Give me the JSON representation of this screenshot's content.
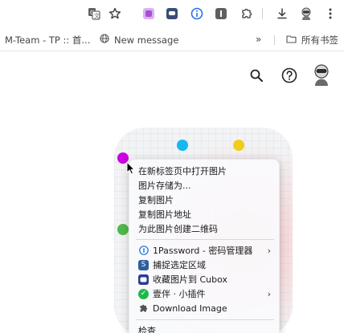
{
  "toolbar": {
    "translate_icon": "translate-icon",
    "star_icon": "bookmark-star-icon",
    "extensions": [
      {
        "name": "extension-purple",
        "color": "#b66be0"
      },
      {
        "name": "extension-dark-blue",
        "color": "#3b4c78"
      },
      {
        "name": "extension-blue-info",
        "color": "#2f6fe0"
      },
      {
        "name": "extension-gray",
        "color": "#6b6b6b"
      }
    ],
    "puzzle_icon": "extensions-puzzle-icon",
    "download_icon": "download-icon",
    "menu_icon": "kebab-menu-icon"
  },
  "bookmarks": {
    "items": [
      {
        "label": "M-Team - TP :: 首..."
      },
      {
        "label": "New message"
      }
    ],
    "overflow": "»",
    "all_bookmarks": "所有书签"
  },
  "page": {
    "dots": [
      {
        "name": "dot-magenta",
        "color": "#cc00e0"
      },
      {
        "name": "dot-cyan",
        "color": "#13b8f0"
      },
      {
        "name": "dot-yellow",
        "color": "#f2cc1a"
      },
      {
        "name": "dot-green",
        "color": "#4fb84a"
      }
    ]
  },
  "context_menu": {
    "group1": [
      "在新标签页中打开图片",
      "图片存储为...",
      "复制图片",
      "复制图片地址",
      "为此图片创建二维码"
    ],
    "group2": [
      {
        "label": "1Password - 密码管理器",
        "icon": "1password-icon",
        "has_submenu": true
      },
      {
        "label": "捕捉选定区域",
        "icon": "snipaste-icon",
        "has_submenu": false
      },
      {
        "label": "收藏图片到 Cubox",
        "icon": "cubox-icon",
        "has_submenu": false
      },
      {
        "label": "壹伴 · 小插件",
        "icon": "yiban-icon",
        "has_submenu": true
      },
      {
        "label": "Download Image",
        "icon": "puzzle-icon",
        "has_submenu": false
      }
    ],
    "group3": [
      "检查"
    ],
    "submenu_arrow": "›"
  }
}
